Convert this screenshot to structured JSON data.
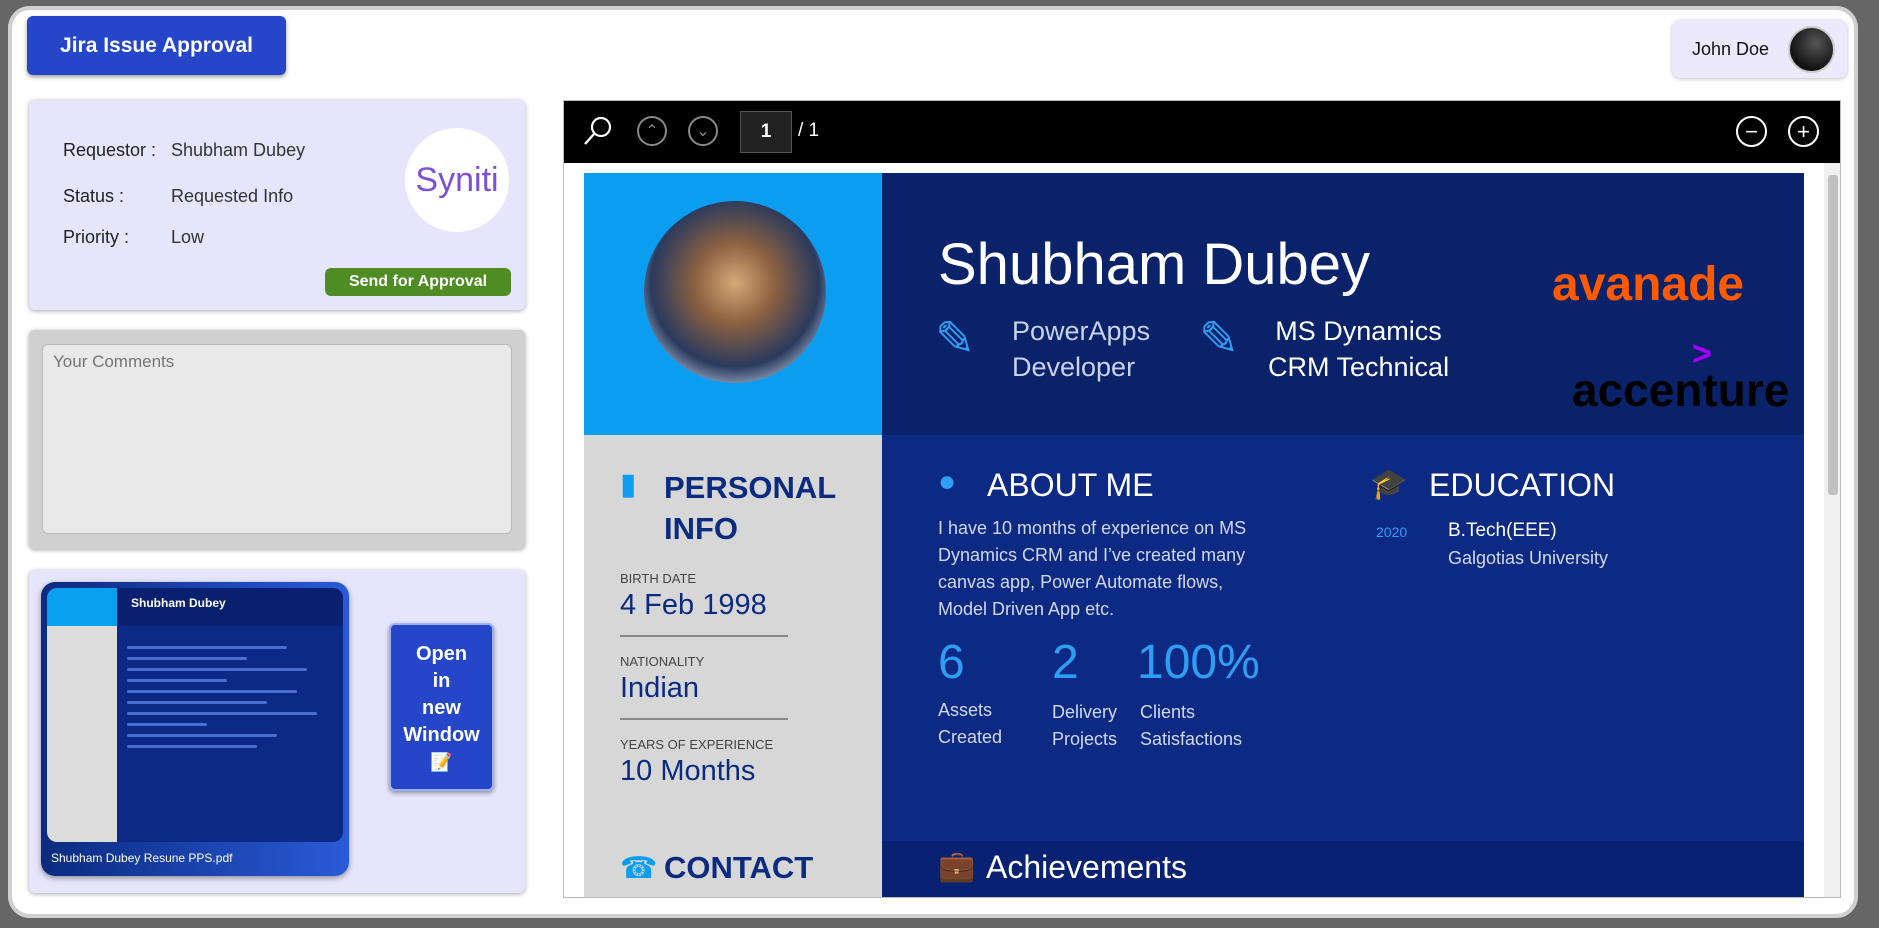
{
  "header": {
    "title": "Jira Issue Approval",
    "user_name": "John Doe"
  },
  "request": {
    "requestor_label": "Requestor :",
    "requestor": "Shubham Dubey",
    "status_label": "Status :",
    "status": "Requested Info",
    "priority_label": "Priority :",
    "priority": "Low",
    "logo_text": "Syniti",
    "send_label": "Send for Approval"
  },
  "comments": {
    "placeholder": "Your Comments"
  },
  "attachment": {
    "file_name": "Shubham Dubey Resune PPS.pdf",
    "open_label_lines": [
      "Open",
      "in",
      "new",
      "Window"
    ],
    "thumb_name": "Shubham Dubey"
  },
  "viewer": {
    "page": "1",
    "total": "/ 1"
  },
  "resume": {
    "name": "Shubham Dubey",
    "role1": [
      "PowerApps",
      "Developer"
    ],
    "role2": [
      "MS Dynamics",
      "CRM Technical"
    ],
    "brand1": "avanade",
    "brand2": "accenture",
    "personal_title": [
      "PERSONAL",
      "INFO"
    ],
    "birth_label": "BIRTH DATE",
    "birth": "4 Feb 1998",
    "nat_label": "NATIONALITY",
    "nat": "Indian",
    "exp_label": "YEARS OF EXPERIENCE",
    "exp": "10 Months",
    "about_title": "ABOUT ME",
    "about_lines": [
      "I have 10 months of experience on MS",
      "Dynamics CRM and I’ve created many",
      "canvas app, Power Automate flows,",
      "Model Driven App etc."
    ],
    "edu_title": "EDUCATION",
    "edu_year": "2020",
    "edu_degree": "B.Tech(EEE)",
    "edu_school": "Galgotias University",
    "stats": [
      {
        "value": "6",
        "label": [
          "Assets",
          "Created"
        ]
      },
      {
        "value": "2",
        "label": [
          "Delivery",
          "Projects"
        ]
      },
      {
        "value": "100%",
        "label": [
          "Clients",
          "Satisfactions"
        ]
      }
    ],
    "achievements_title": "Achievements",
    "contact_title": "CONTACT"
  }
}
